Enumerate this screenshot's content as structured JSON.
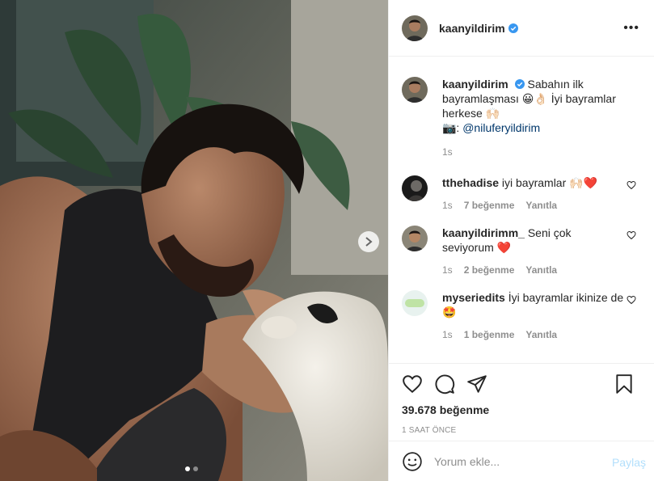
{
  "post": {
    "author": "kaanyildirim",
    "verified_icon": "verified-badge-icon",
    "more_label": "•••"
  },
  "caption": {
    "username": "kaanyildirim",
    "text_line1": "Sabahın ilk bayramlaşması 😀👌🏻 İyi bayramlar herkese 🙌🏻",
    "camera": "📷:",
    "mention": "@niluferyildirim",
    "time": "1s"
  },
  "comments": [
    {
      "username": "tthehadise",
      "text": "iyi bayramlar 🙌🏻❤️",
      "time": "1s",
      "likes": "7 beğenme",
      "reply": "Yanıtla"
    },
    {
      "username": "kaanyildirimm_",
      "text": "Seni çok seviyorum ❤️",
      "time": "1s",
      "likes": "2 beğenme",
      "reply": "Yanıtla"
    },
    {
      "username": "myseriedits",
      "text": "İyi bayramlar ikinize de 🤩",
      "time": "1s",
      "likes": "1 beğenme",
      "reply": "Yanıtla"
    }
  ],
  "stats": {
    "likes": "39.678 beğenme",
    "posted": "1 SAAT ÖNCE"
  },
  "composer": {
    "placeholder": "Yorum ekle...",
    "post_label": "Paylaş"
  },
  "carousel": {
    "current": 1,
    "total": 2
  },
  "colors": {
    "link": "#00376b",
    "heart": "#ed4956",
    "post_disabled": "#b2dffc",
    "verified": "#3897f0"
  }
}
